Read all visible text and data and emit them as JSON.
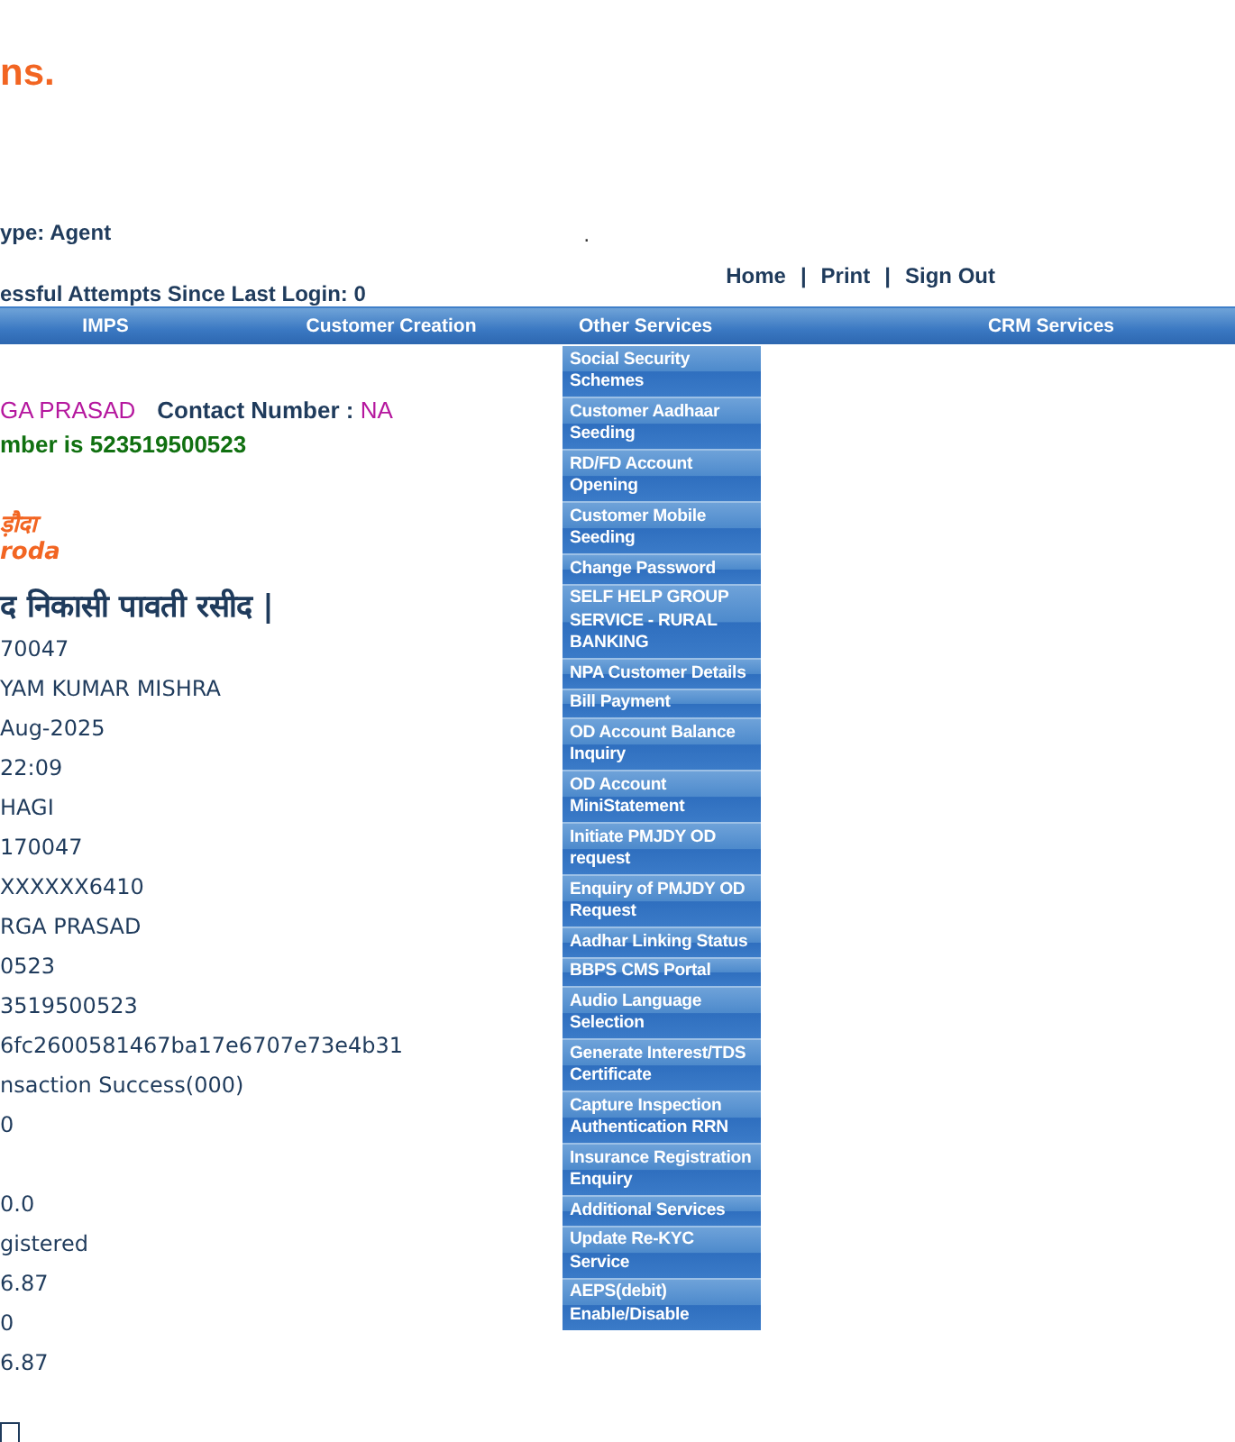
{
  "logo_text": "ns.",
  "user_type": "ype:  Agent",
  "dot": ".",
  "failed_attempts": "essful Attempts Since Last Login: 0",
  "header_links": [
    "Home",
    "Print",
    "Sign Out"
  ],
  "link_separator": "|",
  "nav": [
    {
      "label": "IMPS",
      "expanded": false
    },
    {
      "label": "Customer Creation",
      "expanded": false
    },
    {
      "label": "Other Services",
      "expanded": true,
      "children": [
        "Social Security Schemes",
        "Customer Aadhaar Seeding",
        "RD/FD Account Opening",
        "Customer Mobile Seeding",
        "Change Password",
        "SELF HELP GROUP SERVICE - RURAL BANKING",
        "NPA Customer Details",
        "Bill Payment",
        "OD Account Balance Inquiry",
        "OD Account MiniStatement",
        "Initiate PMJDY OD request",
        "Enquiry of PMJDY OD Request",
        "Aadhar Linking Status",
        "BBPS CMS Portal",
        "Audio Language Selection",
        "Generate Interest/TDS Certificate",
        "Capture Inspection Authentication RRN",
        "Insurance Registration Enquiry",
        "Additional Services",
        "Update Re-KYC Service",
        "AEPS(debit) Enable/Disable"
      ]
    },
    {
      "label": "CRM Services",
      "expanded": false
    }
  ],
  "customer": {
    "name": "GA PRASAD",
    "contact_label": "Contact Number : ",
    "contact_value": "NA",
    "account_line": "mber is 523519500523"
  },
  "bank_logo": [
    "ड़ौदा",
    "roda"
  ],
  "receipt_title": "द निकासी पावती रसीद |",
  "receipt_rows": [
    {
      "kind": "value",
      "text": "70047"
    },
    {
      "kind": "value",
      "text": "YAM KUMAR MISHRA"
    },
    {
      "kind": "value",
      "text": "Aug-2025"
    },
    {
      "kind": "value",
      "text": "22:09"
    },
    {
      "kind": "value",
      "text": "HAGI"
    },
    {
      "kind": "value",
      "text": "170047"
    },
    {
      "kind": "value",
      "text": "XXXXXX6410"
    },
    {
      "kind": "value",
      "text": "RGA PRASAD"
    },
    {
      "kind": "value",
      "text": "0523"
    },
    {
      "kind": "value",
      "text": "3519500523"
    },
    {
      "kind": "value",
      "text": "6fc2600581467ba17e6707e73e4b31"
    },
    {
      "kind": "value",
      "text": "nsaction Success(000)"
    },
    {
      "kind": "value",
      "text": "0"
    },
    {
      "kind": "blank"
    },
    {
      "kind": "value",
      "text": "0.0"
    },
    {
      "kind": "value",
      "text": "gistered"
    },
    {
      "kind": "value",
      "text": "6.87"
    },
    {
      "kind": "value",
      "text": "0"
    },
    {
      "kind": "value",
      "text": "6.87"
    }
  ]
}
